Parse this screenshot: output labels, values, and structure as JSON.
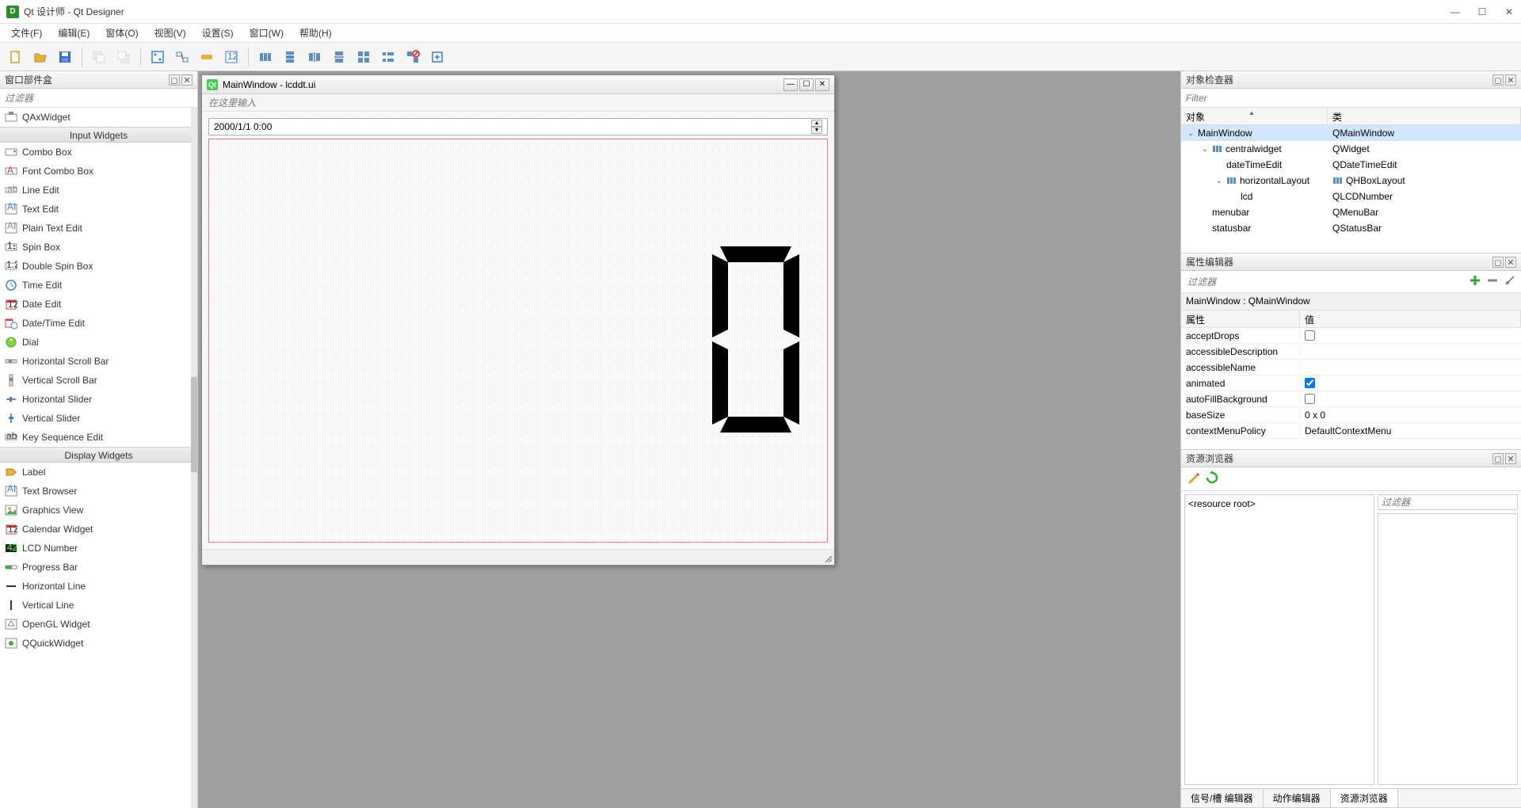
{
  "window": {
    "title": "Qt 设计师 - Qt Designer"
  },
  "menubar": {
    "items": [
      "文件(F)",
      "编辑(E)",
      "窗体(O)",
      "视图(V)",
      "设置(S)",
      "窗口(W)",
      "帮助(H)"
    ]
  },
  "widget_box": {
    "title": "窗口部件盒",
    "filter_placeholder": "过滤器",
    "top_item": "QAxWidget",
    "categories": {
      "input": "Input Widgets",
      "display": "Display Widgets"
    },
    "input_widgets": [
      "Combo Box",
      "Font Combo Box",
      "Line Edit",
      "Text Edit",
      "Plain Text Edit",
      "Spin Box",
      "Double Spin Box",
      "Time Edit",
      "Date Edit",
      "Date/Time Edit",
      "Dial",
      "Horizontal Scroll Bar",
      "Vertical Scroll Bar",
      "Horizontal Slider",
      "Vertical Slider",
      "Key Sequence Edit"
    ],
    "display_widgets": [
      "Label",
      "Text Browser",
      "Graphics View",
      "Calendar Widget",
      "LCD Number",
      "Progress Bar",
      "Horizontal Line",
      "Vertical Line",
      "OpenGL Widget",
      "QQuickWidget"
    ]
  },
  "design": {
    "window_title": "MainWindow - lcddt.ui",
    "menubar_placeholder": "在这里输入",
    "datetime_value": "2000/1/1 0:00"
  },
  "object_inspector": {
    "title": "对象检查器",
    "filter_placeholder": "Filter",
    "col_object": "对象",
    "col_class": "类",
    "rows": [
      {
        "indent": 0,
        "exp": "⌄",
        "icon": "window",
        "name": "MainWindow",
        "class": "QMainWindow",
        "selected": true
      },
      {
        "indent": 1,
        "exp": "⌄",
        "icon": "layout-h",
        "name": "centralwidget",
        "class": "QWidget"
      },
      {
        "indent": 2,
        "exp": "",
        "icon": "",
        "name": "dateTimeEdit",
        "class": "QDateTimeEdit"
      },
      {
        "indent": 2,
        "exp": "⌄",
        "icon": "layout-h",
        "name": "horizontalLayout",
        "class": "QHBoxLayout",
        "classIcon": "layout-h"
      },
      {
        "indent": 3,
        "exp": "",
        "icon": "",
        "name": "lcd",
        "class": "QLCDNumber"
      },
      {
        "indent": 1,
        "exp": "",
        "icon": "",
        "name": "menubar",
        "class": "QMenuBar"
      },
      {
        "indent": 1,
        "exp": "",
        "icon": "",
        "name": "statusbar",
        "class": "QStatusBar"
      }
    ]
  },
  "property_editor": {
    "title": "属性编辑器",
    "filter_placeholder": "过滤器",
    "info": "MainWindow : QMainWindow",
    "col_prop": "属性",
    "col_val": "值",
    "rows": [
      {
        "name": "acceptDrops",
        "type": "checkbox",
        "value": false
      },
      {
        "name": "accessibleDescription",
        "type": "text",
        "value": ""
      },
      {
        "name": "accessibleName",
        "type": "text",
        "value": ""
      },
      {
        "name": "animated",
        "type": "checkbox",
        "value": true
      },
      {
        "name": "autoFillBackground",
        "type": "checkbox",
        "value": false
      },
      {
        "name": "baseSize",
        "type": "text",
        "value": "0 x 0"
      },
      {
        "name": "contextMenuPolicy",
        "type": "text",
        "value": "DefaultContextMenu"
      }
    ]
  },
  "resource_browser": {
    "title": "资源浏览器",
    "filter_placeholder": "过滤器",
    "root": "<resource root>"
  },
  "tabs": {
    "items": [
      "信号/槽 编辑器",
      "动作编辑器",
      "资源浏览器"
    ],
    "active": 2
  }
}
